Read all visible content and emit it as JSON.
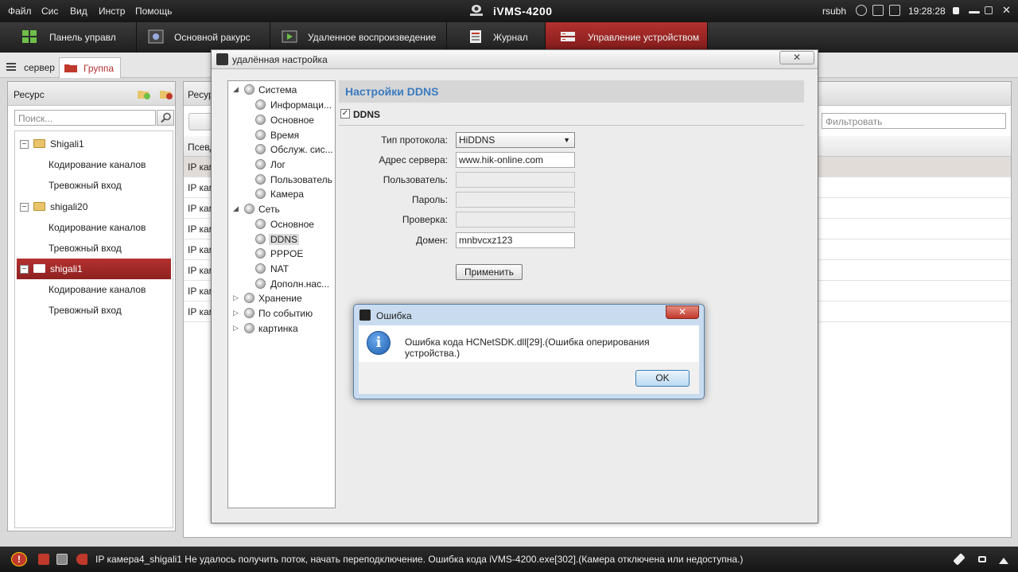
{
  "titlebar": {
    "menu": [
      "Файл",
      "Сис",
      "Вид",
      "Инстр",
      "Помощь"
    ],
    "app_title": "iVMS-4200",
    "user": "rsubh",
    "clock": "19:28:28"
  },
  "modules": [
    {
      "label": "Панель управл",
      "icon": "grid-icon"
    },
    {
      "label": "Основной ракурс",
      "icon": "camera-view-icon"
    },
    {
      "label": "Удаленное воспроизведение",
      "icon": "playback-icon"
    },
    {
      "label": "Журнал",
      "icon": "log-icon"
    },
    {
      "label": "Управление устройством",
      "icon": "device-manage-icon",
      "active": true
    }
  ],
  "subtabs": [
    {
      "label": "сервер",
      "icon": "list-icon"
    },
    {
      "label": "Группа",
      "icon": "folder-icon",
      "active": true
    }
  ],
  "left_panel": {
    "title": "Ресурс",
    "search_placeholder": "Поиск...",
    "tree": [
      {
        "label": "Shigali1",
        "type": "group"
      },
      {
        "label": "Кодирование каналов",
        "type": "child"
      },
      {
        "label": "Тревожный вход",
        "type": "child"
      },
      {
        "label": "shigali20",
        "type": "group"
      },
      {
        "label": "Кодирование каналов",
        "type": "child"
      },
      {
        "label": "Тревожный вход",
        "type": "child"
      },
      {
        "label": "shigali1",
        "type": "group",
        "selected": true
      },
      {
        "label": "Кодирование каналов",
        "type": "child"
      },
      {
        "label": "Тревожный вход",
        "type": "child"
      }
    ]
  },
  "center_panel": {
    "title": "Ресур",
    "filter_placeholder": "Фильтровать",
    "col_header": "Псевд",
    "rows": [
      "IP кам",
      "IP кам",
      "IP кам",
      "IP кам",
      "IP кам",
      "IP кам",
      "IP кам",
      "IP кам"
    ]
  },
  "remote_dialog": {
    "title": "удалённая настройка",
    "close_label": "✕",
    "tree": [
      {
        "label": "Система",
        "level": 0,
        "expanded": true
      },
      {
        "label": "Информаци...",
        "level": 1
      },
      {
        "label": "Основное",
        "level": 1
      },
      {
        "label": "Время",
        "level": 1
      },
      {
        "label": "Обслуж. сис...",
        "level": 1
      },
      {
        "label": "Лог",
        "level": 1
      },
      {
        "label": "Пользователь",
        "level": 1
      },
      {
        "label": "Камера",
        "level": 1
      },
      {
        "label": "Сеть",
        "level": 0,
        "expanded": true
      },
      {
        "label": "Основное",
        "level": 1
      },
      {
        "label": "DDNS",
        "level": 1,
        "selected": true
      },
      {
        "label": "PPPOE",
        "level": 1
      },
      {
        "label": "NAT",
        "level": 1
      },
      {
        "label": "Дополн.нас...",
        "level": 1
      },
      {
        "label": "Хранение",
        "level": 0,
        "expanded": false
      },
      {
        "label": "По событию",
        "level": 0,
        "expanded": false
      },
      {
        "label": "картинка",
        "level": 0,
        "expanded": false
      }
    ],
    "ddns": {
      "header": "Настройки DDNS",
      "checkbox_label": "DDNS",
      "checkbox_checked": "✓",
      "protocol_label": "Тип протокола:",
      "protocol_value": "HiDDNS",
      "server_label": "Адрес сервера:",
      "server_value": "www.hik-online.com",
      "user_label": "Пользователь:",
      "user_value": "",
      "password_label": "Пароль:",
      "password_value": "",
      "verify_label": "Проверка:",
      "verify_value": "",
      "domain_label": "Домен:",
      "domain_value": "mnbvcxz123",
      "apply_label": "Применить"
    }
  },
  "error_dialog": {
    "title": "Ошибка",
    "message": "Ошибка кода HCNetSDK.dll[29].(Ошибка оперирования устройства.)",
    "ok_label": "OK",
    "close_label": "✕",
    "info_glyph": "i"
  },
  "statusbar": {
    "warn_glyph": "!",
    "message": "IP камера4_shigali1 Не удалось получить поток, начать переподключение. Ошибка кода iVMS-4200.exe[302].(Камера отключена или недоступна.)"
  },
  "colors": {
    "accent_red": "#b3312f",
    "ddns_header_blue": "#3b7bbf"
  }
}
